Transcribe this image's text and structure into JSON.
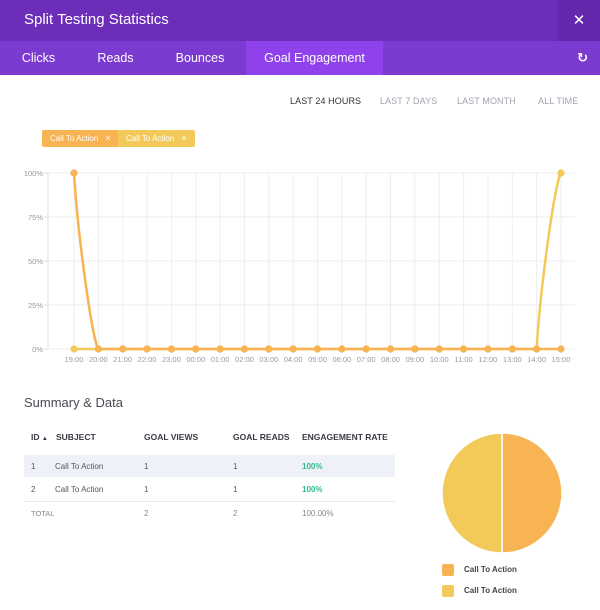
{
  "header": {
    "title": "Split Testing Statistics",
    "close_icon": "close-icon"
  },
  "tabs": [
    {
      "label": "Clicks",
      "active": false
    },
    {
      "label": "Reads",
      "active": false
    },
    {
      "label": "Bounces",
      "active": false
    },
    {
      "label": "Goal Engagement",
      "active": true
    }
  ],
  "refresh_icon": "refresh-icon",
  "ranges": [
    {
      "label": "LAST 24 HOURS",
      "active": true
    },
    {
      "label": "LAST 7 DAYS",
      "active": false
    },
    {
      "label": "LAST MONTH",
      "active": false
    },
    {
      "label": "ALL TIME",
      "active": false
    }
  ],
  "filters": [
    {
      "label": "Call To Action",
      "remove": "×",
      "color": "#f8b352"
    },
    {
      "label": "Call To Action",
      "remove": "×",
      "color": "#f3ca5a"
    }
  ],
  "colors": {
    "series1": "#f8b352",
    "series2": "#f3ca5a",
    "header": "#6c2eb9",
    "tabbar": "#7b3ad0",
    "tab_active": "#8f42ec",
    "rate": "#2bbd8c"
  },
  "chart_data": [
    {
      "type": "line",
      "title": "",
      "xlabel": "",
      "ylabel": "",
      "x": [
        "19:00",
        "20:00",
        "21:00",
        "22:00",
        "23:00",
        "00:00",
        "01:00",
        "02:00",
        "03:00",
        "04:00",
        "05:00",
        "06:00",
        "07:00",
        "08:00",
        "09:00",
        "10:00",
        "11:00",
        "12:00",
        "13:00",
        "14:00",
        "15:00"
      ],
      "yticks": [
        "0%",
        "25%",
        "50%",
        "75%",
        "100%"
      ],
      "ylim": [
        0,
        100
      ],
      "grid": true,
      "series": [
        {
          "name": "Call To Action",
          "color": "#f8b352",
          "values": [
            100,
            0,
            0,
            0,
            0,
            0,
            0,
            0,
            0,
            0,
            0,
            0,
            0,
            0,
            0,
            0,
            0,
            0,
            0,
            0,
            0
          ]
        },
        {
          "name": "Call To Action",
          "color": "#f3ca5a",
          "values": [
            0,
            0,
            0,
            0,
            0,
            0,
            0,
            0,
            0,
            0,
            0,
            0,
            0,
            0,
            0,
            0,
            0,
            0,
            0,
            0,
            100
          ]
        }
      ]
    },
    {
      "type": "pie",
      "title": "",
      "slices": [
        {
          "label": "Call To Action",
          "value": 50,
          "color": "#f8b352"
        },
        {
          "label": "Call To Action",
          "value": 50,
          "color": "#f3ca5a"
        }
      ],
      "legend": "bottom"
    }
  ],
  "summary": {
    "title": "Summary & Data",
    "columns": [
      "ID",
      "SUBJECT",
      "GOAL VIEWS",
      "GOAL READS",
      "ENGAGEMENT RATE"
    ],
    "sort_icon": "sort-asc-icon",
    "rows": [
      {
        "id": "1",
        "subject": "Call To Action",
        "views": "1",
        "reads": "1",
        "rate": "100%"
      },
      {
        "id": "2",
        "subject": "Call To Action",
        "views": "1",
        "reads": "1",
        "rate": "100%"
      }
    ],
    "total": {
      "label": "TOTAL",
      "views": "2",
      "reads": "2",
      "rate": "100.00%"
    }
  },
  "legend": [
    {
      "label": "Call To Action",
      "color": "#f8b352"
    },
    {
      "label": "Call To Action",
      "color": "#f3ca5a"
    }
  ]
}
